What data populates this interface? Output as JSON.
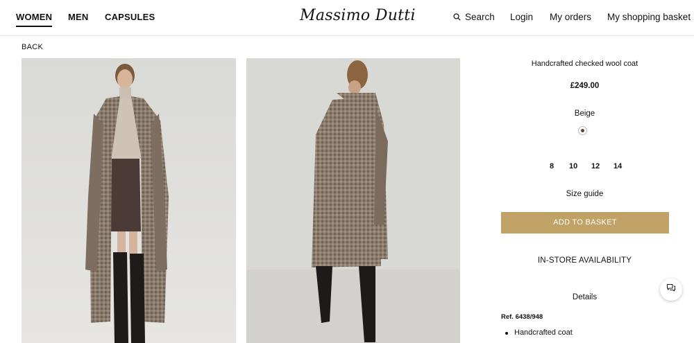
{
  "header": {
    "nav": [
      {
        "label": "WOMEN"
      },
      {
        "label": "MEN"
      },
      {
        "label": "CAPSULES"
      }
    ],
    "logo": "Massimo Dutti",
    "search_label": "Search",
    "login_label": "Login",
    "orders_label": "My orders",
    "basket_label": "My shopping basket"
  },
  "back_label": "BACK",
  "product": {
    "name": "Handcrafted checked wool coat",
    "price": "£249.00",
    "color_name": "Beige",
    "sizes": [
      "8",
      "10",
      "12",
      "14"
    ],
    "size_guide": "Size guide",
    "add_to_basket": "ADD TO BASKET",
    "in_store": "IN-STORE AVAILABILITY",
    "details_label": "Details",
    "ref": "Ref. 6438/948",
    "features": [
      "Handcrafted coat"
    ]
  },
  "colors": {
    "accent": "#c1a266",
    "swatch": "#5a4638"
  },
  "icons": {
    "search": "search-icon",
    "chat": "chat-icon"
  }
}
